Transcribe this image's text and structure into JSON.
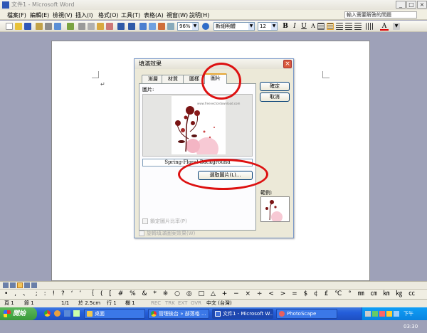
{
  "window": {
    "title": "文件1 - Microsoft Word",
    "minimize": "_",
    "maximize": "□",
    "close": "×"
  },
  "menu": {
    "items": [
      "檔案(F)",
      "編輯(E)",
      "檢視(V)",
      "插入(I)",
      "格式(O)",
      "工具(T)",
      "表格(A)",
      "視窗(W)",
      "說明(H)"
    ],
    "help_placeholder": "輸入需要解答的問題"
  },
  "toolbar": {
    "zoom": "96%",
    "font": "新細明體",
    "size": "12",
    "bold": "B",
    "italic": "I",
    "underline": "U",
    "font_color_label": "A"
  },
  "dialog": {
    "title": "填滿效果",
    "close": "×",
    "tabs": [
      "漸層",
      "材質",
      "圖樣",
      "圖片"
    ],
    "selected_tab": "圖片",
    "picture_label": "圖片:",
    "picture_name": "Spring-Floral Background",
    "select_button": "選取圖片(L)...",
    "ok_button": "確定",
    "cancel_button": "取消",
    "lock_ratio": "鎖定圖片比率(P)",
    "rotate_fill": "旋轉填滿圖案效果(W)",
    "sample_label": "範例:",
    "image_caption": "www.freevectordownload.com"
  },
  "symbols": "• , 、 ; : ! ? ‘ ’ ｛ ( [ # % & * ※ ○ ◎ □ △ + − × ÷ < > = $ ¢ £ ℃ ° ㎜ ㎝ ㎞ ㎏ ㏄",
  "status": {
    "page": "頁 1",
    "section": "節 1",
    "pages": "1/1",
    "position": "於 2.5cm",
    "line": "行 1",
    "column": "欄 1",
    "rec": "REC",
    "trk": "TRK",
    "ext": "EXT",
    "ovr": "OVR",
    "language": "中文 (台灣)"
  },
  "taskbar": {
    "start": "開始",
    "tasks": [
      "桌面",
      "管理後台 » 部落格 ...",
      "文件1 - Microsoft W...",
      "PhotoScape"
    ],
    "clock": "下午 03:30"
  },
  "colors": {
    "accent_red": "#d11111",
    "workspace": "#9ea1b8",
    "taskbar": "#245edb"
  }
}
